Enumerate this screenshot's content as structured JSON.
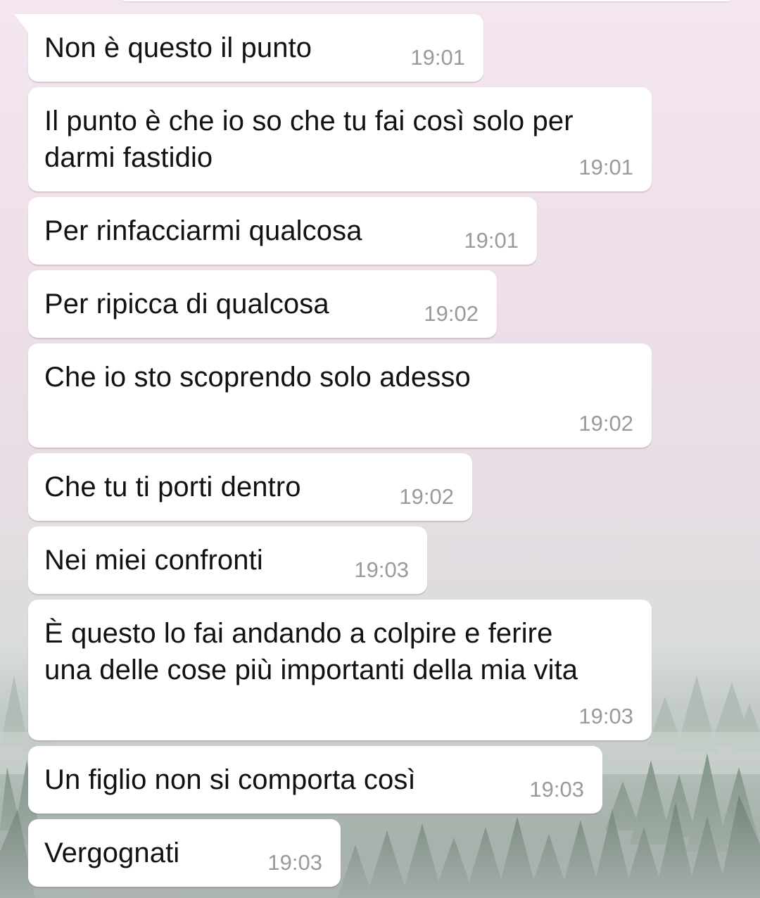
{
  "chat": {
    "messages": [
      {
        "text": "Non è questo il punto",
        "time": "19:01"
      },
      {
        "text": "Il punto è che io so che tu fai così solo per\ndarmi fastidio",
        "time": "19:01"
      },
      {
        "text": "Per rinfacciarmi qualcosa",
        "time": "19:01"
      },
      {
        "text": "Per ripicca di qualcosa",
        "time": "19:02"
      },
      {
        "text": "Che io sto scoprendo solo adesso",
        "time": "19:02"
      },
      {
        "text": "Che tu ti porti dentro",
        "time": "19:02"
      },
      {
        "text": "Nei miei confronti",
        "time": "19:03"
      },
      {
        "text": "È questo lo fai andando a colpire e ferire\nuna delle cose più importanti della mia vita",
        "time": "19:03"
      },
      {
        "text": "Un figlio non si comporta così",
        "time": "19:03"
      },
      {
        "text": "Vergognati",
        "time": "19:03"
      }
    ]
  },
  "colors": {
    "bubble": "#ffffff",
    "timestamp": "#9a9a9a",
    "text": "#111111"
  }
}
